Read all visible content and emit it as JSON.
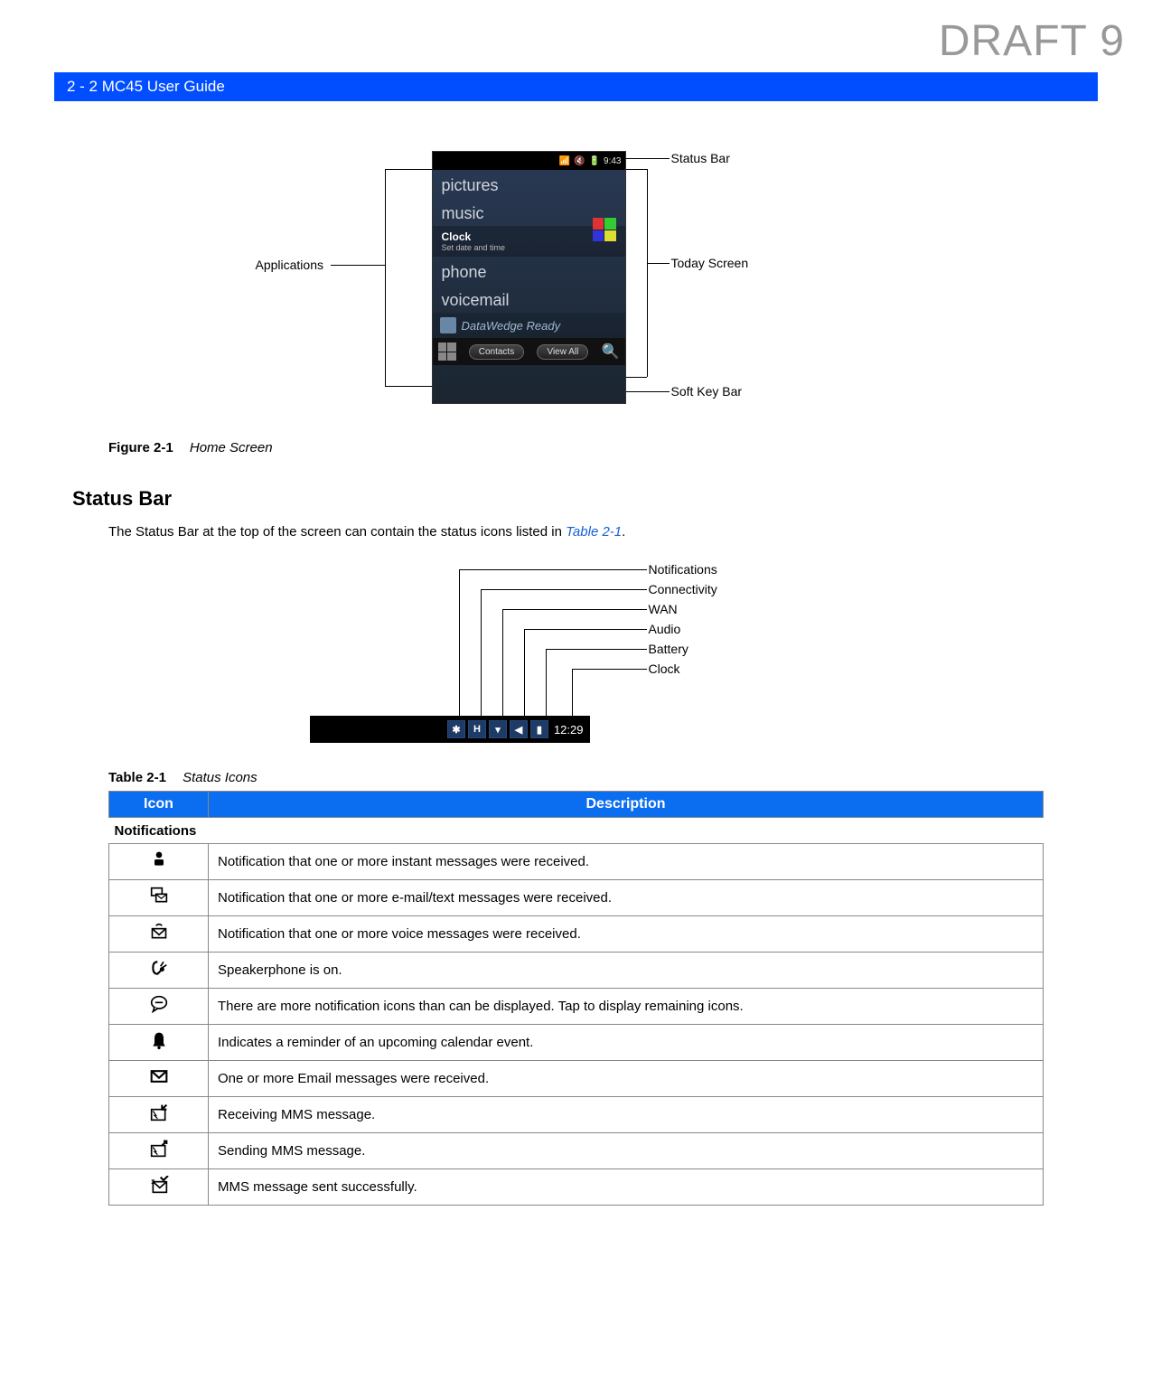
{
  "watermark": "DRAFT 9",
  "header": "2 - 2    MC45 User Guide",
  "figure1": {
    "screen": {
      "status_time": "9:43",
      "pictures": "pictures",
      "music": "music",
      "clock_title": "Clock",
      "clock_sub": "Set date and time",
      "phone": "phone",
      "voicemail": "voicemail",
      "datawedge": "DataWedge Ready",
      "soft_left": "Contacts",
      "soft_right": "View All"
    },
    "callouts": {
      "applications": "Applications",
      "status_bar": "Status Bar",
      "today_screen": "Today Screen",
      "soft_key_bar": "Soft Key Bar"
    },
    "caption_label": "Figure 2-1",
    "caption_title": "Home Screen"
  },
  "section_status_bar": "Status Bar",
  "status_bar_text_pre": "The Status Bar at the top of the screen can contain the status icons listed in ",
  "status_bar_text_link": "Table 2-1",
  "status_bar_text_post": ".",
  "sb_diagram": {
    "time": "12:29",
    "labels": {
      "notifications": "Notifications",
      "connectivity": "Connectivity",
      "wan": "WAN",
      "audio": "Audio",
      "battery": "Battery",
      "clock": "Clock"
    }
  },
  "table": {
    "caption_label": "Table 2-1",
    "caption_title": "Status Icons",
    "col_icon": "Icon",
    "col_desc": "Description",
    "section_notifications": "Notifications",
    "rows": [
      "Notification that one or more instant messages were received.",
      "Notification that one or more e-mail/text messages were received.",
      "Notification that one or more voice messages were received.",
      "Speakerphone is on.",
      "There are more notification icons than can be displayed. Tap to display remaining icons.",
      "Indicates a reminder of an upcoming calendar event.",
      "One or more Email messages were received.",
      "Receiving MMS message.",
      "Sending MMS message.",
      "MMS message sent successfully."
    ]
  }
}
